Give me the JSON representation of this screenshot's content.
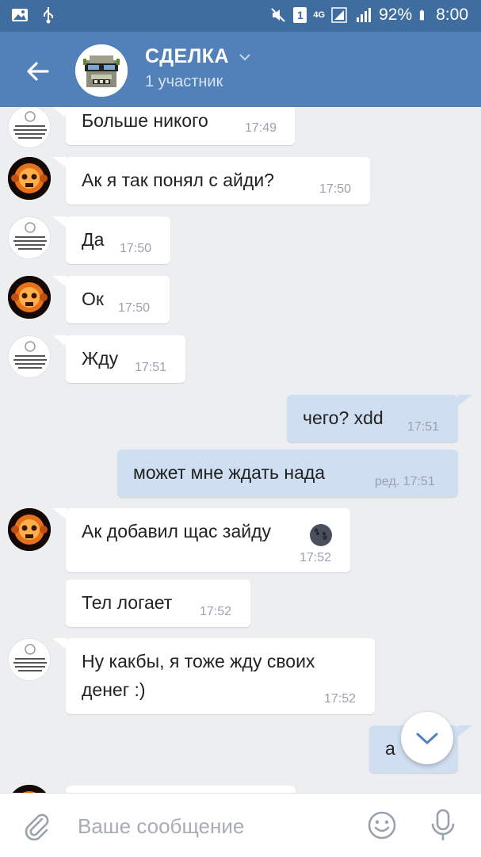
{
  "status_bar": {
    "notification_count": "1",
    "network": "4G",
    "battery": "92%",
    "time": "8:00"
  },
  "header": {
    "title": "СДЕЛКА",
    "subtitle": "1 участник"
  },
  "messages": [
    {
      "text": "Больше никого",
      "time": "17:49",
      "direction": "in",
      "avatar": "meme"
    },
    {
      "text": "Ак я так понял с айди?",
      "time": "17:50",
      "direction": "in",
      "avatar": "skull"
    },
    {
      "text": "Да",
      "time": "17:50",
      "direction": "in",
      "avatar": "meme"
    },
    {
      "text": "Ок",
      "time": "17:50",
      "direction": "in",
      "avatar": "skull"
    },
    {
      "text": "Жду",
      "time": "17:51",
      "direction": "in",
      "avatar": "meme"
    },
    {
      "text": "чего? xdd",
      "time": "17:51",
      "direction": "out"
    },
    {
      "text": "может мне ждать нада",
      "time": "ред. 17:51",
      "direction": "out"
    },
    {
      "text": "Ак добавил щас зайду",
      "time": "17:52",
      "direction": "in",
      "avatar": "skull"
    },
    {
      "text": "Тел логает",
      "time": "17:52",
      "direction": "in"
    },
    {
      "text": "Ну какбы, я тоже жду своих",
      "text2": "денег :)",
      "time": "17:52",
      "direction": "in",
      "avatar": "meme"
    },
    {
      "text": "а",
      "time": "",
      "direction": "out"
    }
  ],
  "input": {
    "placeholder": "Ваше сообщение"
  },
  "colors": {
    "status_bar": "#3f6da0",
    "header": "#5181b8",
    "background": "#edeef0",
    "outgoing_bubble": "#cfdef0",
    "incoming_bubble": "#ffffff"
  }
}
